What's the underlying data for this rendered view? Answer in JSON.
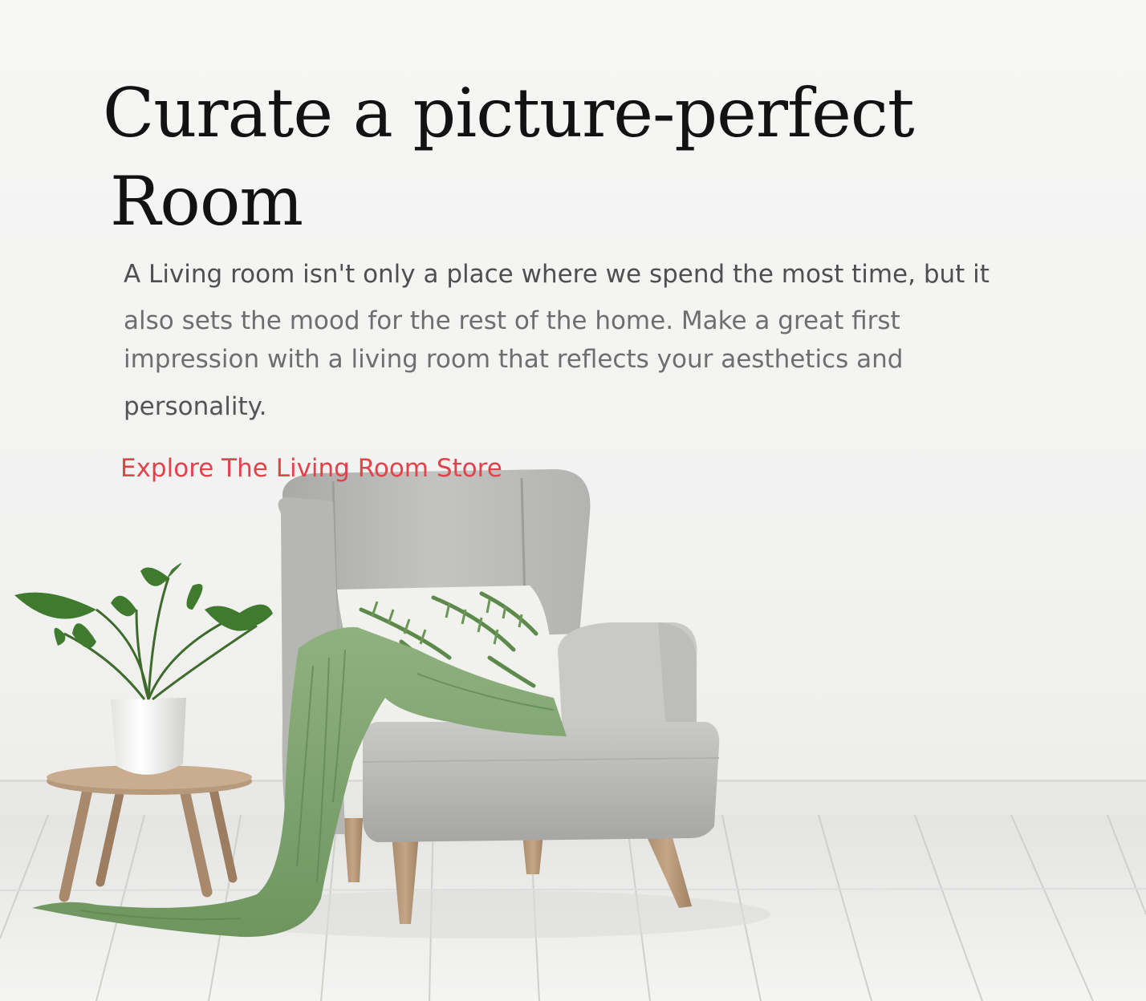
{
  "hero": {
    "headline_line1": "Curate a picture-perfect",
    "headline_line2": "Room",
    "body_line1": "A Living room isn't only a place where we spend the most time, but it",
    "body_line2": "also sets the mood for the rest of the home. Make a great first",
    "body_line3": "impression with a living room that reflects your aesthetics and",
    "body_line4": "personality.",
    "cta_label": "Explore The Living Room Store",
    "accent_color": "#e0434a"
  },
  "scene": {
    "items": [
      "armchair",
      "palm-leaf-cushion",
      "green-throw-blanket",
      "potted-plant",
      "wooden-side-table",
      "wooden-floor"
    ]
  }
}
